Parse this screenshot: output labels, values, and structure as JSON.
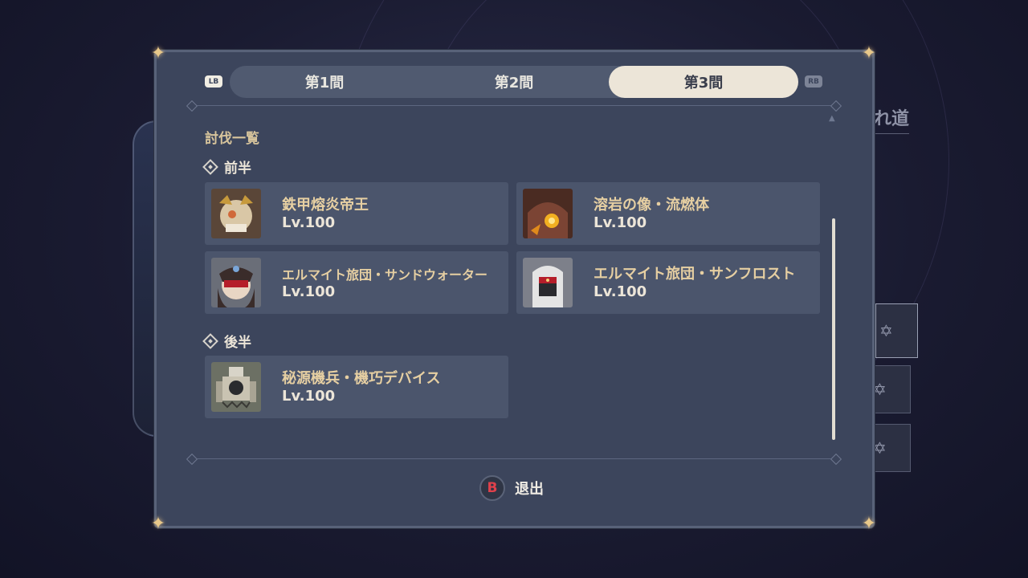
{
  "tabs": [
    "第1間",
    "第2間",
    "第3間"
  ],
  "active_tab": 2,
  "shoulder": {
    "left": "LB",
    "right": "RB"
  },
  "section_title": "討伐一覧",
  "groups": {
    "first": {
      "label": "前半"
    },
    "second": {
      "label": "後半"
    }
  },
  "enemies": [
    {
      "name": "鉄甲熔炎帝王",
      "level": "Lv.100",
      "icon": "armored-lava-emperor-portrait"
    },
    {
      "name": "溶岩の像・流燃体",
      "level": "Lv.100",
      "icon": "lava-statue-portrait"
    },
    {
      "name": "エルマイト旅団・サンドウォーター",
      "level": "Lv.100",
      "icon": "eremite-sandwater-portrait"
    },
    {
      "name": "エルマイト旅団・サンフロスト",
      "level": "Lv.100",
      "icon": "eremite-sunfrost-portrait"
    },
    {
      "name": "秘源機兵・機巧デバイス",
      "level": "Lv.100",
      "icon": "secret-source-device-portrait"
    }
  ],
  "exit": {
    "button": "B",
    "label": "退出"
  },
  "background": {
    "partial_text": "れ道"
  },
  "colors": {
    "accent_gold": "#e6cfa2",
    "panel": "#3c455c",
    "active_tab": "#ece5d8",
    "b_button": "#e0414b"
  }
}
